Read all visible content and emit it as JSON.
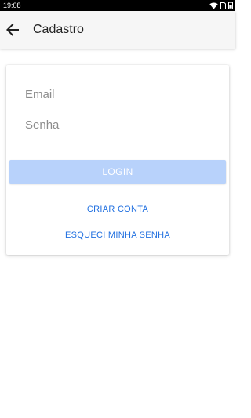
{
  "status_bar": {
    "time": "19:08",
    "icons": [
      "wifi-icon",
      "sim-icon",
      "battery-icon"
    ]
  },
  "app_bar": {
    "title": "Cadastro",
    "back_icon": "arrow-left-icon"
  },
  "form": {
    "email": {
      "placeholder": "Email",
      "value": ""
    },
    "password": {
      "placeholder": "Senha",
      "value": ""
    },
    "login_label": "LOGIN",
    "create_account_label": "CRIAR CONTA",
    "forgot_password_label": "ESQUECI MINHA SENHA"
  },
  "colors": {
    "accent": "#1f6fe0",
    "login_button_bg": "#b8d2fb",
    "app_bar_bg": "#f6f6f6",
    "status_bar_bg": "#000000"
  }
}
